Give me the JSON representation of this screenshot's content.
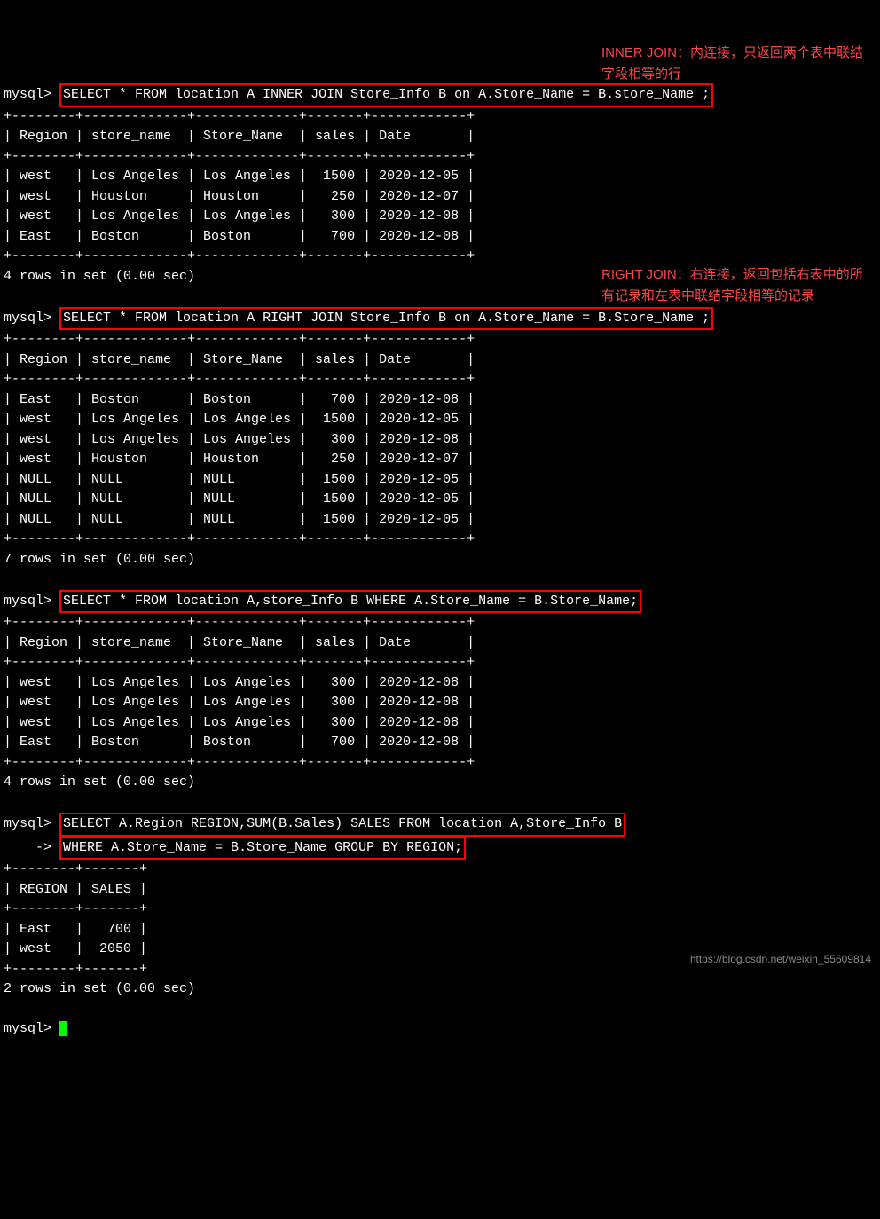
{
  "prompt": "mysql>",
  "cont_prompt": "    ->",
  "queries": {
    "q1": "SELECT * FROM location A INNER JOIN Store_Info B on A.Store_Name = B.store_Name ;",
    "q2": "SELECT * FROM location A RIGHT JOIN Store_Info B on A.Store_Name = B.Store_Name ;",
    "q3": "SELECT * FROM location A,store_Info B WHERE A.Store_Name = B.Store_Name;",
    "q4_line1": "SELECT A.Region REGION,SUM(B.Sales) SALES FROM location A,Store_Info B",
    "q4_line2": "WHERE A.Store_Name = B.Store_Name GROUP BY REGION;"
  },
  "table1": {
    "separator": "+--------+-------------+-------------+-------+------------+",
    "header": "| Region | store_name  | Store_Name  | sales | Date       |",
    "rows": [
      "| west   | Los Angeles | Los Angeles |  1500 | 2020-12-05 |",
      "| west   | Houston     | Houston     |   250 | 2020-12-07 |",
      "| west   | Los Angeles | Los Angeles |   300 | 2020-12-08 |",
      "| East   | Boston      | Boston      |   700 | 2020-12-08 |"
    ],
    "footer": "4 rows in set (0.00 sec)"
  },
  "table2": {
    "separator": "+--------+-------------+-------------+-------+------------+",
    "header": "| Region | store_name  | Store_Name  | sales | Date       |",
    "rows": [
      "| East   | Boston      | Boston      |   700 | 2020-12-08 |",
      "| west   | Los Angeles | Los Angeles |  1500 | 2020-12-05 |",
      "| west   | Los Angeles | Los Angeles |   300 | 2020-12-08 |",
      "| west   | Houston     | Houston     |   250 | 2020-12-07 |",
      "| NULL   | NULL        | NULL        |  1500 | 2020-12-05 |",
      "| NULL   | NULL        | NULL        |  1500 | 2020-12-05 |",
      "| NULL   | NULL        | NULL        |  1500 | 2020-12-05 |"
    ],
    "footer": "7 rows in set (0.00 sec)"
  },
  "table3": {
    "separator": "+--------+-------------+-------------+-------+------------+",
    "header": "| Region | store_name  | Store_Name  | sales | Date       |",
    "rows": [
      "| west   | Los Angeles | Los Angeles |   300 | 2020-12-08 |",
      "| west   | Los Angeles | Los Angeles |   300 | 2020-12-08 |",
      "| west   | Los Angeles | Los Angeles |   300 | 2020-12-08 |",
      "| East   | Boston      | Boston      |   700 | 2020-12-08 |"
    ],
    "footer": "4 rows in set (0.00 sec)"
  },
  "table4": {
    "separator": "+--------+-------+",
    "header": "| REGION | SALES |",
    "rows": [
      "| East   |   700 |",
      "| west   |  2050 |"
    ],
    "footer": "2 rows in set (0.00 sec)"
  },
  "annotations": {
    "a1": "INNER JOIN：内连接，只返回两个表中联结字段相等的行",
    "a2": "RIGHT JOIN：右连接，返回包括右表中的所有记录和左表中联结字段相等的记录"
  },
  "watermark": "https://blog.csdn.net/weixin_55609814"
}
